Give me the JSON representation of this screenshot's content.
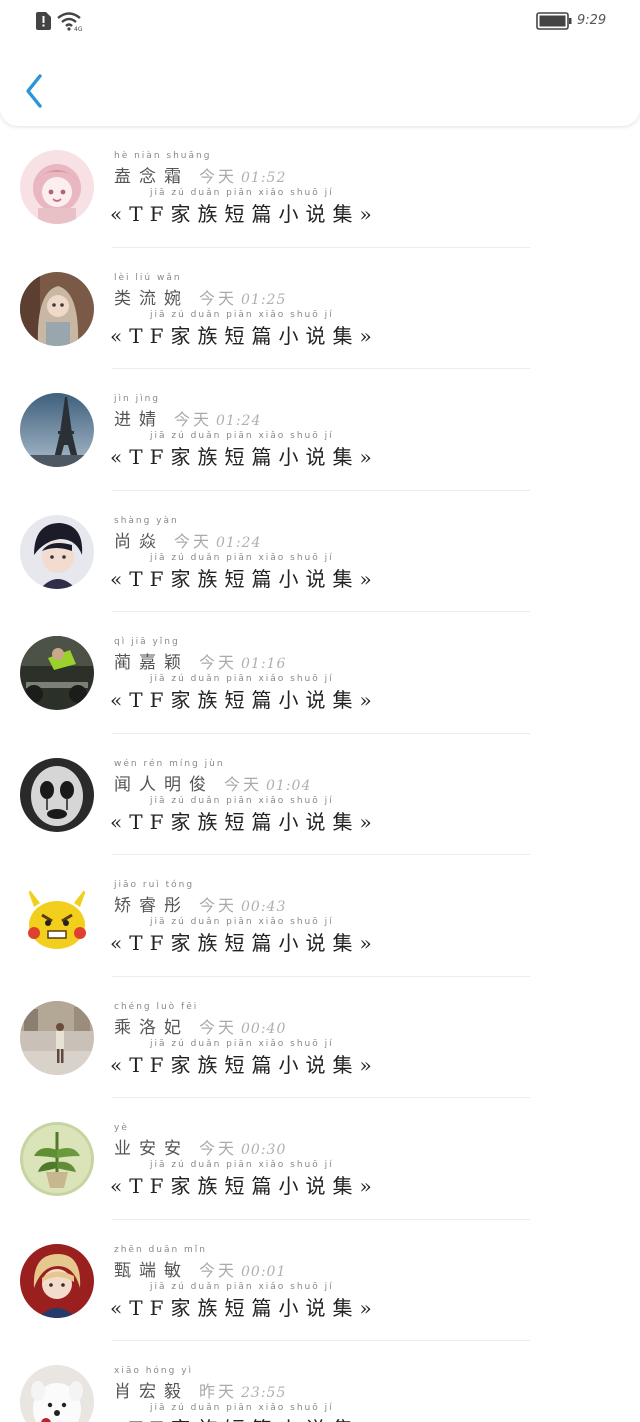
{
  "status_bar": {
    "time": "9:29"
  },
  "colors": {
    "accent": "#2b95d6",
    "background": "#ffffff",
    "time_text": "#aaaaaa"
  },
  "icons": {
    "sim": "sim-card-alert-icon",
    "wifi": "wifi-icon",
    "battery": "battery-icon",
    "back": "chevron-left-icon"
  },
  "messages": [
    {
      "name_pinyin": "hè niàn shuāng",
      "name": "盍念霜",
      "day_pinyin": "jīn tiān",
      "day": "今天",
      "time": "01:52",
      "message_pinyin": "jiā zú duǎn piān xiǎo shuō jí",
      "message": "«TF家族短篇小说集»",
      "avatar": "anime-girl"
    },
    {
      "name_pinyin": "lèi liú wǎn",
      "name": "类流婉",
      "day_pinyin": "jīn tiān",
      "day": "今天",
      "time": "01:25",
      "message_pinyin": "jiā zú duǎn piān xiǎo shuō jí",
      "message": "«TF家族短篇小说集»",
      "avatar": "doll"
    },
    {
      "name_pinyin": "jìn jìng",
      "name": "进婧",
      "day_pinyin": "jīn tiān",
      "day": "今天",
      "time": "01:24",
      "message_pinyin": "jiā zú duǎn piān xiǎo shuō jí",
      "message": "«TF家族短篇小说集»",
      "avatar": "eiffel-tower"
    },
    {
      "name_pinyin": "shàng yàn",
      "name": "尚焱",
      "day_pinyin": "jīn tiān",
      "day": "今天",
      "time": "01:24",
      "message_pinyin": "jiā zú duǎn piān xiǎo shuō jí",
      "message": "«TF家族短篇小说集»",
      "avatar": "young-man"
    },
    {
      "name_pinyin": "qì jiā yǐng",
      "name": "蔺嘉颖",
      "day_pinyin": "jīn tiān",
      "day": "今天",
      "time": "01:16",
      "message_pinyin": "jiā zú duǎn piān xiǎo shuō jí",
      "message": "«TF家族短篇小说集»",
      "avatar": "gym"
    },
    {
      "name_pinyin": "wén rén míng jùn",
      "name": "闻人明俊",
      "day_pinyin": "jīn tiān",
      "day": "今天",
      "time": "01:04",
      "message_pinyin": "jiā zú duǎn piān xiǎo shuō jí",
      "message": "«TF家族短篇小说集»",
      "avatar": "mask"
    },
    {
      "name_pinyin": "jiāo ruì tóng",
      "name": "矫睿彤",
      "day_pinyin": "jīn tiān",
      "day": "今天",
      "time": "00:43",
      "message_pinyin": "jiā zú duǎn piān xiǎo shuō jí",
      "message": "«TF家族短篇小说集»",
      "avatar": "pikachu"
    },
    {
      "name_pinyin": "chéng luò fēi",
      "name": "乘洛妃",
      "day_pinyin": "jīn tiān",
      "day": "今天",
      "time": "00:40",
      "message_pinyin": "jiā zú duǎn piān xiǎo shuō jí",
      "message": "«TF家族短篇小说集»",
      "avatar": "street"
    },
    {
      "name_pinyin": "yè",
      "name": "业安安",
      "day_pinyin": "jīn tiān",
      "day": "今天",
      "time": "00:30",
      "message_pinyin": "jiā zú duǎn piān xiǎo shuō jí",
      "message": "«TF家族短篇小说集»",
      "avatar": "plant"
    },
    {
      "name_pinyin": "zhēn duān mǐn",
      "name": "甄端敏",
      "day_pinyin": "jīn tiān",
      "day": "今天",
      "time": "00:01",
      "message_pinyin": "jiā zú duǎn piān xiǎo shuō jí",
      "message": "«TF家族短篇小说集»",
      "avatar": "blonde-man"
    },
    {
      "name_pinyin": "xiāo hóng yì",
      "name": "肖宏毅",
      "day_pinyin": "zuó tiān",
      "day": "昨天",
      "time": "23:55",
      "message_pinyin": "jiā zú duǎn piān xiǎo shuō jí",
      "message": "«TF家族短篇小说集»",
      "avatar": "dog-rose"
    }
  ]
}
